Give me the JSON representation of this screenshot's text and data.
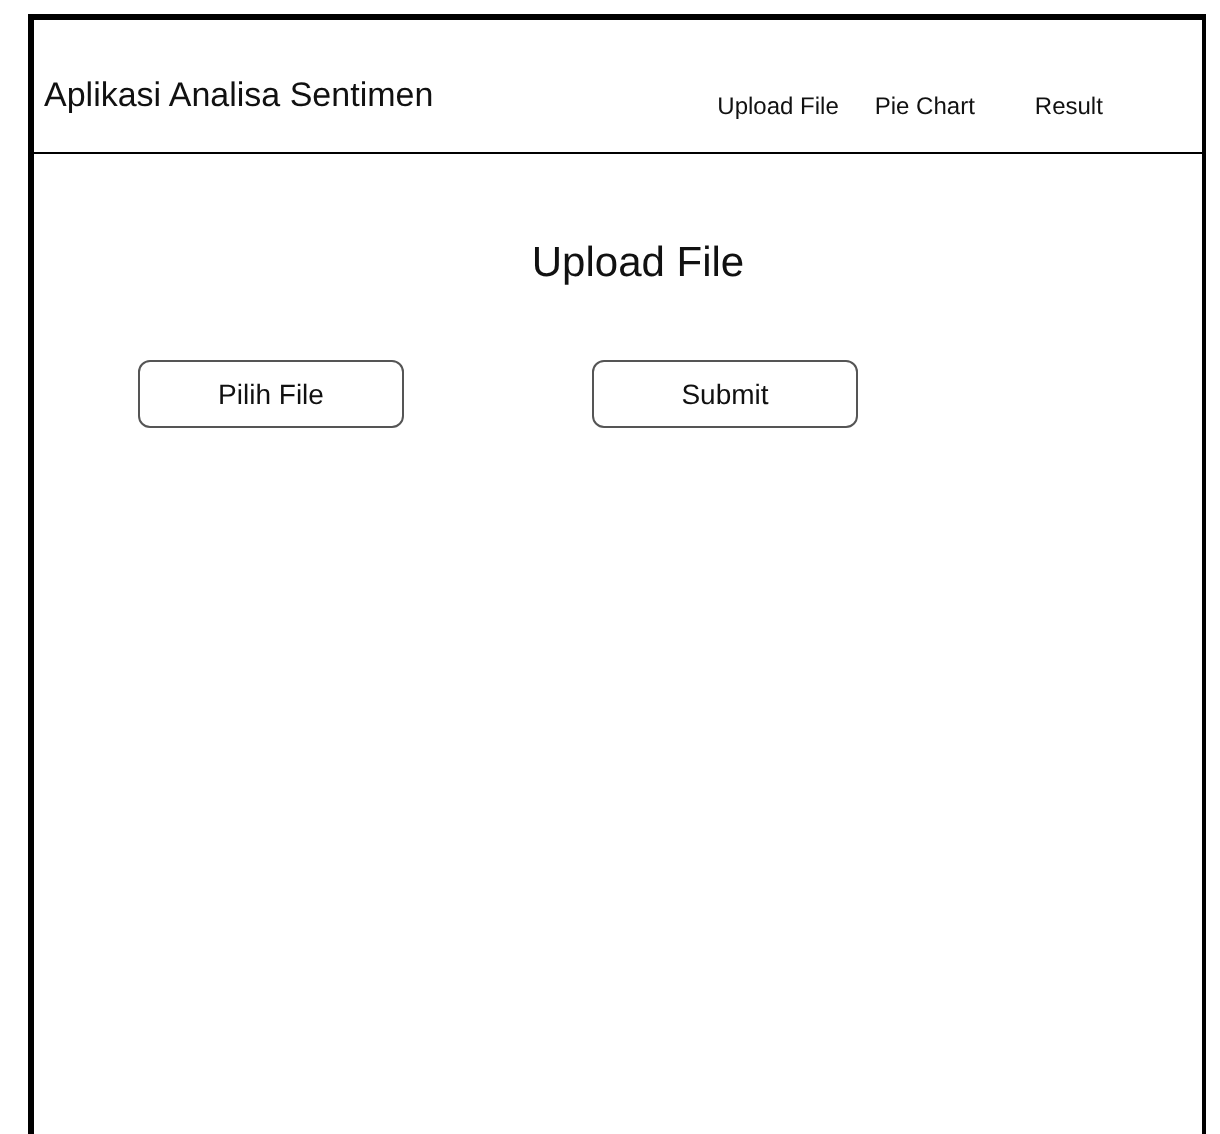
{
  "header": {
    "title": "Aplikasi Analisa Sentimen",
    "nav": [
      {
        "label": "Upload File"
      },
      {
        "label": "Pie Chart"
      },
      {
        "label": "Result"
      }
    ]
  },
  "heading": "Upload File",
  "buttons": [
    {
      "label": "Pilih File"
    },
    {
      "label": "Submit"
    }
  ]
}
